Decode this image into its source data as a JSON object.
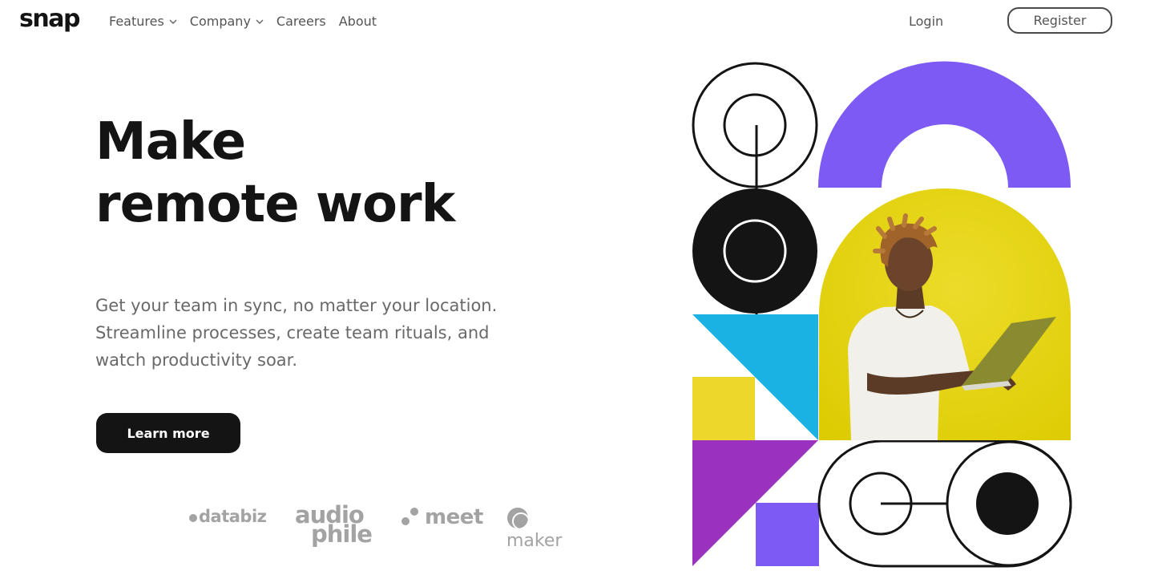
{
  "header": {
    "logo": "snap",
    "nav": [
      {
        "label": "Features",
        "dropdown": true
      },
      {
        "label": "Company",
        "dropdown": true
      },
      {
        "label": "Careers",
        "dropdown": false
      },
      {
        "label": "About",
        "dropdown": false
      }
    ],
    "login_label": "Login",
    "register_label": "Register"
  },
  "hero": {
    "title_line1": "Make",
    "title_line2": "remote work",
    "description_line1": "Get your team in sync, no matter your location.",
    "description_line2": "Streamline processes, create team rituals, and",
    "description_line3": "watch productivity soar.",
    "cta_label": "Learn more"
  },
  "clients": {
    "databiz": "databiz",
    "audiophile_line1": "audio",
    "audiophile_line2": "phile",
    "meet": "meet",
    "maker": "maker"
  },
  "colors": {
    "text_dark": "#141414",
    "text_muted": "#696969",
    "purple": "#7c5af3",
    "yellow": "#e8d300",
    "cyan": "#1ab2e2",
    "magenta": "#9b32bf",
    "client_gray": "#a3a3a3"
  }
}
